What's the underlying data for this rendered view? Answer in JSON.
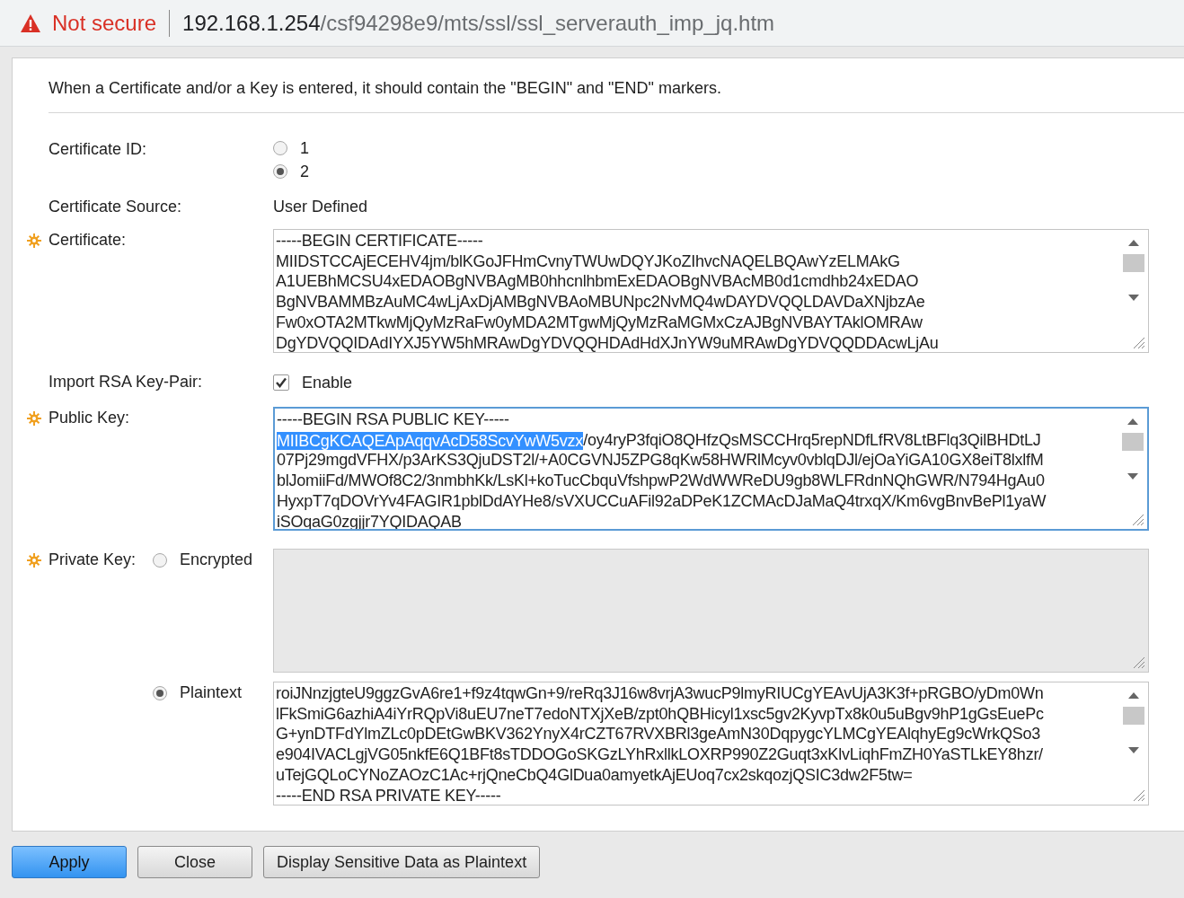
{
  "address_bar": {
    "security_label": "Not secure",
    "host": "192.168.1.254",
    "path": "/csf94298e9/mts/ssl/ssl_serverauth_imp_jq.htm"
  },
  "notice": "When a Certificate and/or a Key is entered, it should contain the \"BEGIN\" and \"END\" markers.",
  "certificate_id": {
    "label": "Certificate ID:",
    "options": [
      {
        "label": "1",
        "selected": false
      },
      {
        "label": "2",
        "selected": true
      }
    ]
  },
  "certificate_source": {
    "label": "Certificate Source:",
    "value": "User Defined"
  },
  "certificate": {
    "label": "Certificate:",
    "required": true,
    "focused": false,
    "lines": [
      {
        "text": "-----BEGIN CERTIFICATE-----"
      },
      {
        "text": "MIIDSTCCAjECEHV4jm/blKGoJFHmCvnyTWUwDQYJKoZIhvcNAQELBQAwYzELMAkG"
      },
      {
        "text": "A1UEBhMCSU4xEDAOBgNVBAgMB0hhcnlhbmExEDAOBgNVBAcMB0d1cmdhb24xEDAO"
      },
      {
        "text": "BgNVBAMMBzAuMC4wLjAxDjAMBgNVBAoMBUNpc2NvMQ4wDAYDVQQLDAVDaXNjbzAe"
      },
      {
        "text": "Fw0xOTA2MTkwMjQyMzRaFw0yMDA2MTgwMjQyMzRaMGMxCzAJBgNVBAYTAklOMRAw"
      },
      {
        "text": "DgYDVQQIDAdIYXJ5YW5hMRAwDgYDVQQHDAdHdXJnYW9uMRAwDgYDVQQDDAcwLjAu"
      }
    ]
  },
  "import_rsa": {
    "label": "Import RSA Key-Pair:",
    "checkbox_label": "Enable",
    "checked": true
  },
  "public_key": {
    "label": "Public Key:",
    "required": true,
    "focused": true,
    "lines": [
      {
        "text": "-----BEGIN RSA PUBLIC KEY-----"
      },
      {
        "selection": "MIIBCgKCAQEApAqqvAcD58ScvYwW5vzx",
        "text": "/oy4ryP3fqiO8QHfzQsMSCCHrq5repNDfLfRV8LtBFlq3QilBHDtLJ"
      },
      {
        "text": "07Pj29mgdVFHX/p3ArKS3QjuDST2l/+A0CGVNJ5ZPG8qKw58HWRlMcyv0vblqDJl/ejOaYiGA10GX8eiT8lxlfM"
      },
      {
        "text": "blJomiiFd/MWOf8C2/3nmbhKk/LsKl+koTucCbquVfshpwP2WdWWReDU9gb8WLFRdnNQhGWR/N794HgAu0"
      },
      {
        "text": "HyxpT7qDOVrYv4FAGIR1pblDdAYHe8/sVXUCCuAFil92aDPeK1ZCMAcDJaMaQ4trxqX/Km6vgBnvBePl1yaW"
      },
      {
        "text": "iSOqaG0zgjjr7YQIDAQAB"
      }
    ]
  },
  "private_key": {
    "label": "Private Key:",
    "required": true,
    "options": [
      {
        "label": "Encrypted",
        "selected": false,
        "disabled": true
      },
      {
        "label": "Plaintext",
        "selected": true,
        "disabled": false,
        "lines": [
          {
            "text": "roiJNnzjgteU9ggzGvA6re1+f9z4tqwGn+9/reRq3J16w8vrjA3wucP9lmyRIUCgYEAvUjA3K3f+pRGBO/yDm0Wn"
          },
          {
            "text": "lFkSmiG6azhiA4iYrRQpVi8uEU7neT7edoNTXjXeB/zpt0hQBHicyl1xsc5gv2KyvpTx8k0u5uBgv9hP1gGsEuePc"
          },
          {
            "text": "G+ynDTFdYlmZLc0pDEtGwBKV362YnyX4rCZT67RVXBRl3geAmN30DqpygcYLMCgYEAlqhyEg9cWrkQSo3"
          },
          {
            "text": "e904IVACLgjVG05nkfE6Q1BFt8sTDDOGoSKGzLYhRxllkLOXRP990Z2Guqt3xKlvLiqhFmZH0YaSTLkEY8hzr/"
          },
          {
            "text": "uTejGQLoCYNoZAOzC1Ac+rjQneCbQ4GlDua0amyetkAjEUoq7cx2skqozjQSIC3dw2F5tw="
          },
          {
            "text": "-----END RSA PRIVATE KEY-----"
          }
        ]
      }
    ]
  },
  "buttons": [
    {
      "label": "Apply",
      "kind": "primary"
    },
    {
      "label": "Close",
      "kind": "normal"
    },
    {
      "label": "Display Sensitive Data as Plaintext",
      "kind": "normal"
    }
  ]
}
